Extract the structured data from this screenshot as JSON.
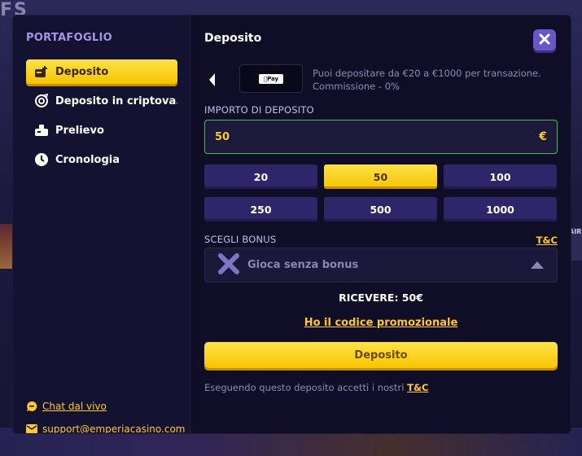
{
  "backdrop": {
    "corner_text": "FS",
    "side_text": "AIR"
  },
  "sidebar": {
    "title": "PORTAFOGLIO",
    "items": [
      {
        "label": "Deposito",
        "icon": "wallet-plus-icon",
        "active": true
      },
      {
        "label": "Deposito in criptova...",
        "icon": "crypto-coin-icon",
        "active": false
      },
      {
        "label": "Prelievo",
        "icon": "withdraw-icon",
        "active": false
      },
      {
        "label": "Cronologia",
        "icon": "clock-icon",
        "active": false
      }
    ],
    "footer": {
      "chat_label": "Chat dal vivo",
      "email_label": "support@emperiacasino.com"
    }
  },
  "main": {
    "title": "Deposito",
    "method": {
      "badge": "Pay",
      "info_line1": "Puoi depositare da €20 a €1000 per transazione.",
      "info_line2": "Commissione - 0%"
    },
    "amount_label": "IMPORTO DI DEPOSITO",
    "amount_value": "50",
    "currency": "€",
    "presets": [
      "20",
      "50",
      "100",
      "250",
      "500",
      "1000"
    ],
    "selected_preset": "50",
    "bonus_label": "SCEGLI BONUS",
    "tc_label": "T&C",
    "bonus_value": "Gioca senza bonus",
    "receive_text": "RICEVERE: 50€",
    "promo_label": "Ho il codice promozionale",
    "submit_label": "Deposito",
    "terms_text": "Eseguendo questo deposito accetti i nostri",
    "terms_link": "T&C"
  },
  "colors": {
    "accent": "#ffc928",
    "panel": "#100e26",
    "button_purple": "#2e2669",
    "input_border": "#35c05a"
  }
}
